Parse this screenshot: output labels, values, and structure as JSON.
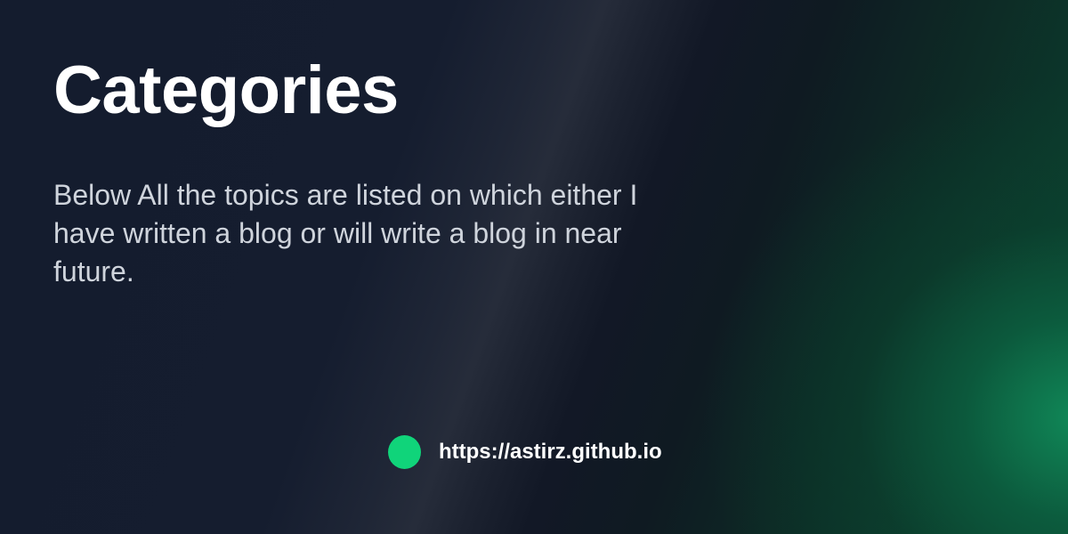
{
  "title": "Categories",
  "description": "Below All the topics are listed on which either I have written a blog or will write a blog in near future.",
  "footer": {
    "url": "https://astirz.github.io"
  },
  "colors": {
    "accent_dot": "#10d47a",
    "background_dark": "#141c2e",
    "background_green": "#108c5a",
    "title_text": "#ffffff",
    "body_text": "#cfd4dc"
  }
}
